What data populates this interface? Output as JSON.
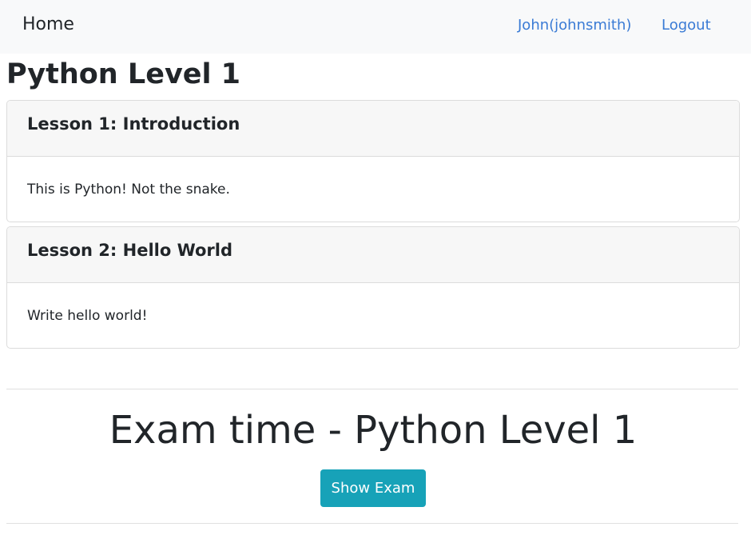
{
  "navbar": {
    "brand": "Home",
    "user_link": "John(johnsmith)",
    "logout_link": "Logout",
    "link_color": "#3a7bd5"
  },
  "course": {
    "title": "Python Level 1"
  },
  "lessons": [
    {
      "title": "Lesson 1: Introduction",
      "body": "This is Python! Not the snake."
    },
    {
      "title": "Lesson 2: Hello World",
      "body": "Write hello world!"
    }
  ],
  "exam": {
    "title": "Exam time - Python Level 1",
    "button_label": "Show Exam",
    "button_color": "#17a2b8"
  }
}
